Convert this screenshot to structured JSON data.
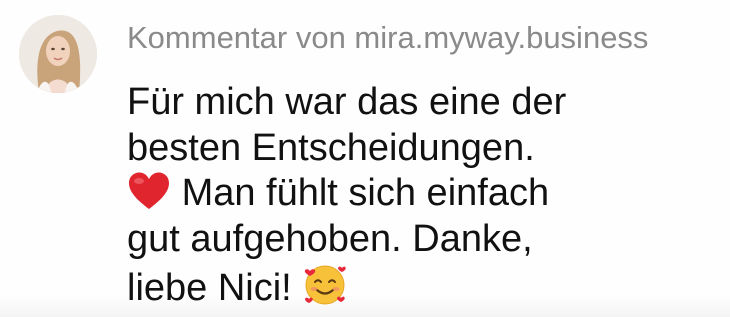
{
  "comment": {
    "author_line": "Kommentar von mira.myway.business",
    "avatar_icon": "profile-photo",
    "lines": [
      "Für mich war das eine der",
      "besten Entscheidungen.",
      "Man fühlt sich einfach",
      "gut aufgehoben. Danke,",
      "liebe Nici!"
    ],
    "emojis": {
      "heart": "red-heart-icon",
      "smile": "smiling-face-with-hearts-icon"
    }
  },
  "colors": {
    "author_text": "#8a8a8a",
    "body_text": "#111111",
    "heart": "#e0252f",
    "smile_face": "#f7c23a"
  }
}
